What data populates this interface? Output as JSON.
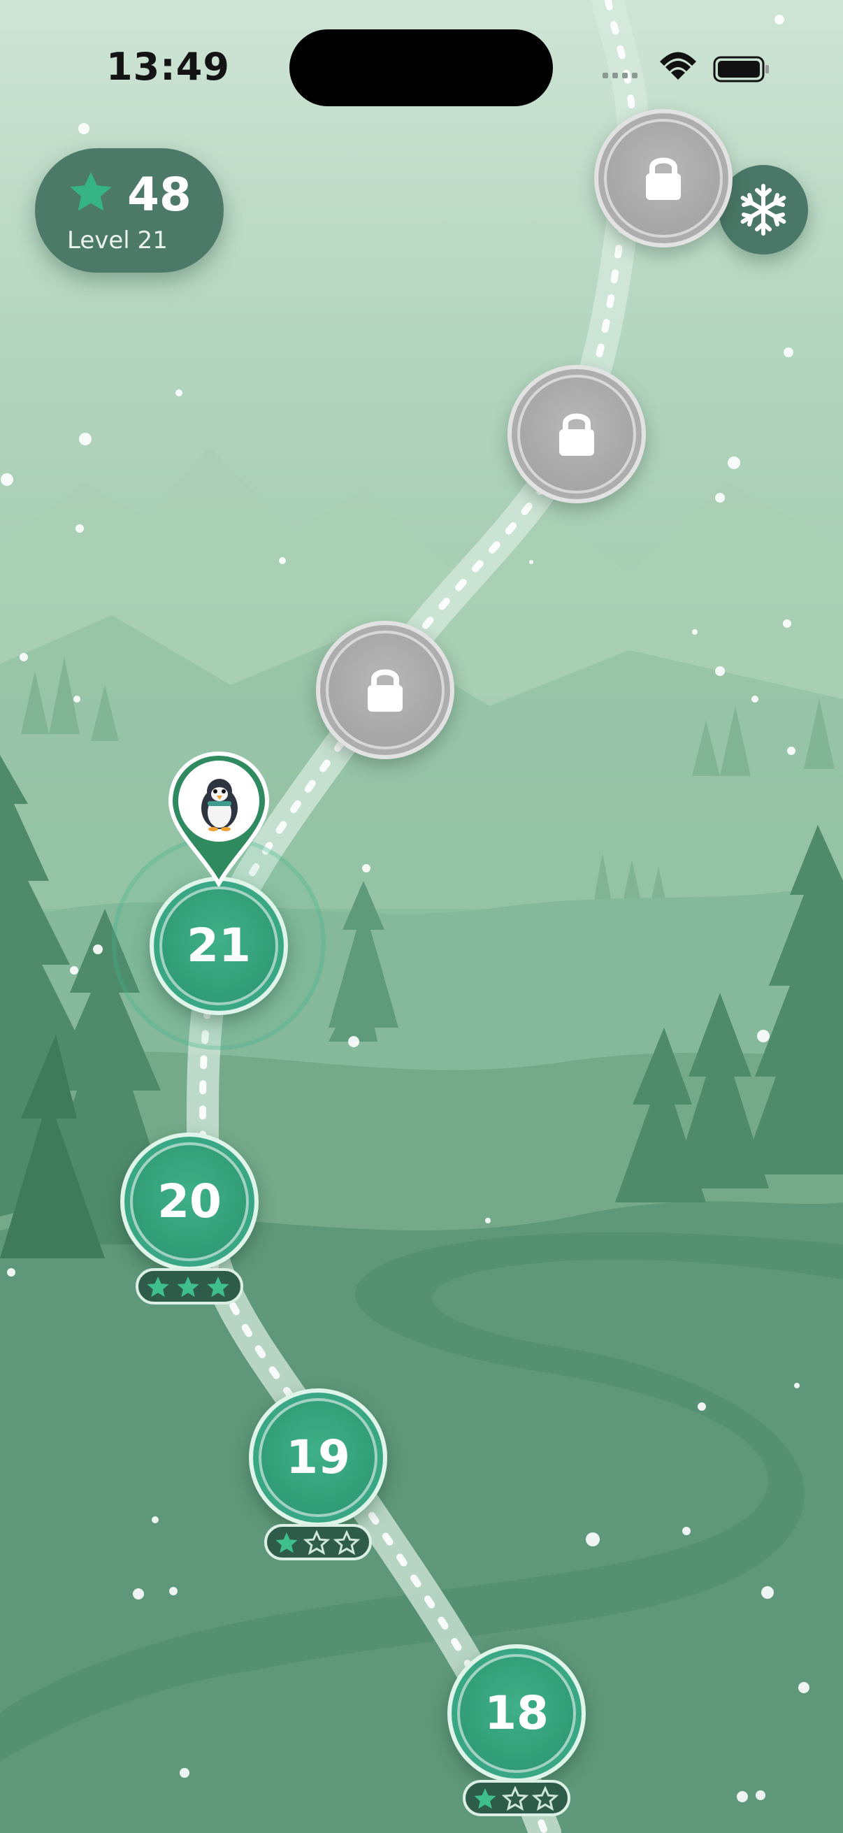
{
  "status_bar": {
    "time": "13:49"
  },
  "hud": {
    "stars_total": "48",
    "level_label": "Level 21"
  },
  "freeze_button": {
    "icon": "snowflake-icon"
  },
  "map": {
    "current_level": "21",
    "levels": [
      {
        "label": "21",
        "state": "current",
        "stars": 0
      },
      {
        "label": "20",
        "state": "completed",
        "stars": 3
      },
      {
        "label": "19",
        "state": "completed",
        "stars": 1
      },
      {
        "label": "18",
        "state": "completed",
        "stars": 1
      },
      {
        "label": "",
        "state": "locked",
        "stars": 0
      },
      {
        "label": "",
        "state": "locked",
        "stars": 0
      },
      {
        "label": "",
        "state": "locked",
        "stars": 0
      }
    ],
    "avatar": "penguin-icon"
  },
  "colors": {
    "accent_green": "#34a882",
    "pill_bg": "#4d7a68",
    "locked_gray": "#a8a8a8",
    "badge_bg": "#2f5c4a"
  }
}
